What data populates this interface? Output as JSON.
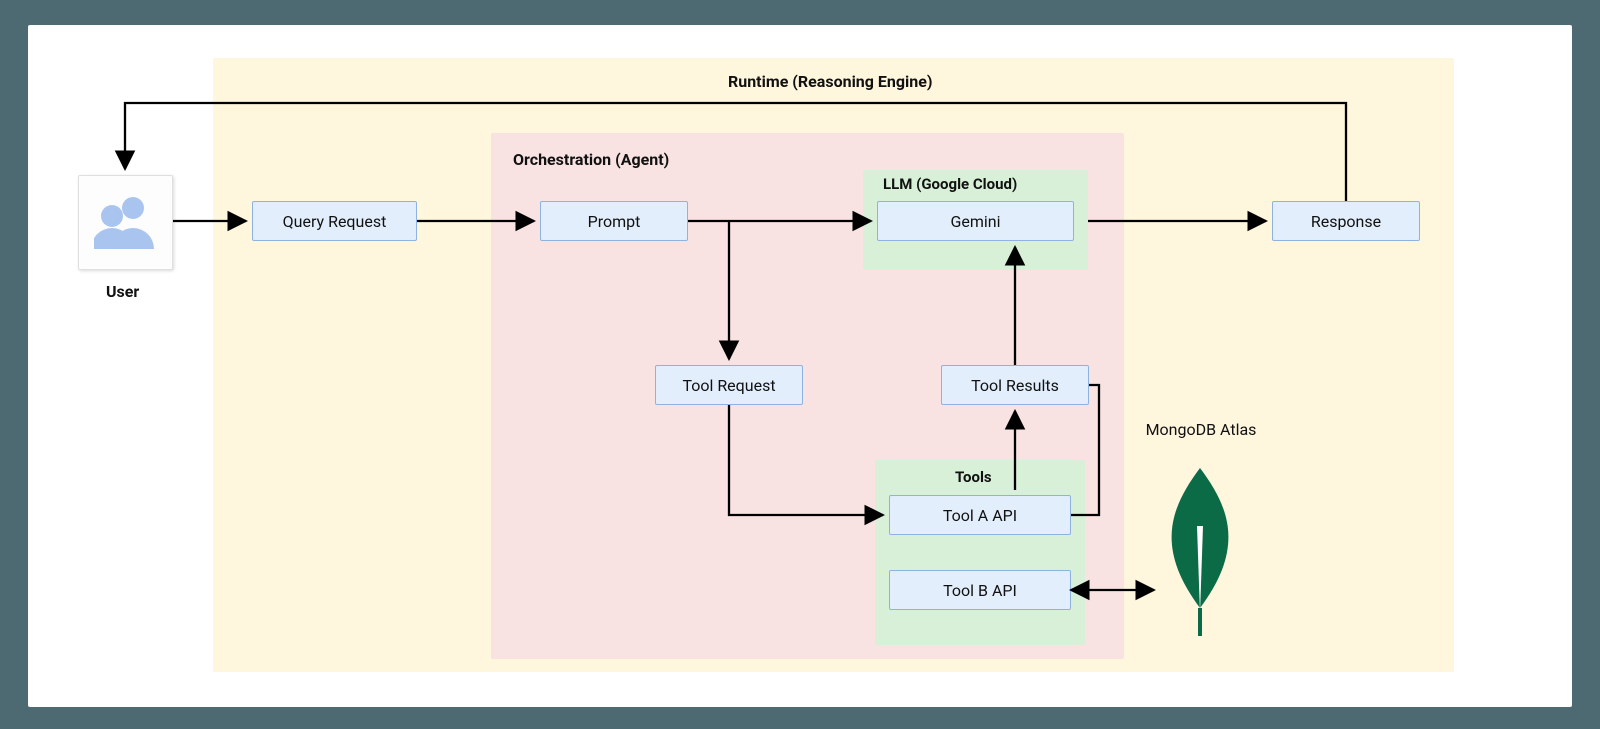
{
  "user_label": "User",
  "runtime_label": "Runtime (Reasoning Engine)",
  "orchestration_label": "Orchestration (Agent)",
  "llm_label": "LLM (Google Cloud)",
  "tools_label": "Tools",
  "nodes": {
    "query_request": "Query Request",
    "prompt": "Prompt",
    "gemini": "Gemini",
    "response": "Response",
    "tool_request": "Tool Request",
    "tool_results": "Tool Results",
    "tool_a": "Tool A API",
    "tool_b": "Tool B API"
  },
  "mongo_label": "MongoDB Atlas",
  "colors": {
    "page_bg": "#4d6a73",
    "card_bg": "#ffffff",
    "runtime_bg": "#fef6dd",
    "orchestration_bg": "#f9e2e2",
    "llm_bg": "#d8f0d8",
    "node_fill": "#e3eefc",
    "node_border": "#8fb3e0",
    "mongo_green": "#0b6b46"
  }
}
